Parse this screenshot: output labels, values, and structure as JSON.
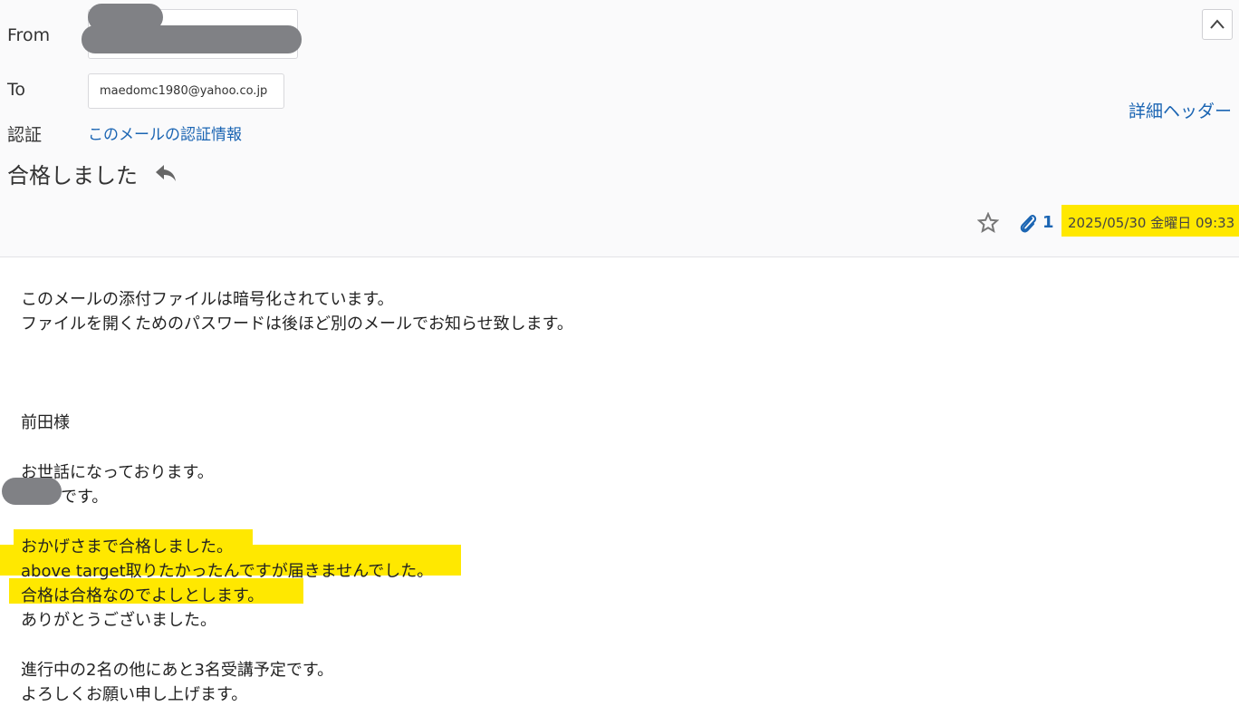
{
  "header": {
    "from_label": "From",
    "to_label": "To",
    "to_address": "maedomc1980@yahoo.co.jp",
    "auth_label": "認証",
    "auth_link": "このメールの認証情報",
    "detail_header_link": "詳細ヘッダー",
    "subject": "合格しました",
    "attachment_count": "1",
    "date": "2025/05/30 金曜日 09:33"
  },
  "body": {
    "lines": [
      "このメールの添付ファイルは暗号化されています。",
      "ファイルを開くためのパスワードは後ほど別のメールでお知らせ致します。",
      "前田様",
      "お世話になっております。",
      "です。",
      "おかげさまで合格しました。",
      "above target取りたかったんですが届きませんでした。",
      "合格は合格なのでよしとします。",
      "ありがとうございました。",
      "進行中の2名の他にあと3名受講予定です。",
      "よろしくお願い申し上げます。"
    ]
  },
  "icons": {
    "reply": "reply-icon",
    "collapse": "chevron-up-icon",
    "star": "star-icon",
    "attachment": "paperclip-icon"
  },
  "colors": {
    "highlight": "#ffe800",
    "link": "#1b65b3",
    "redaction": "#808185"
  }
}
